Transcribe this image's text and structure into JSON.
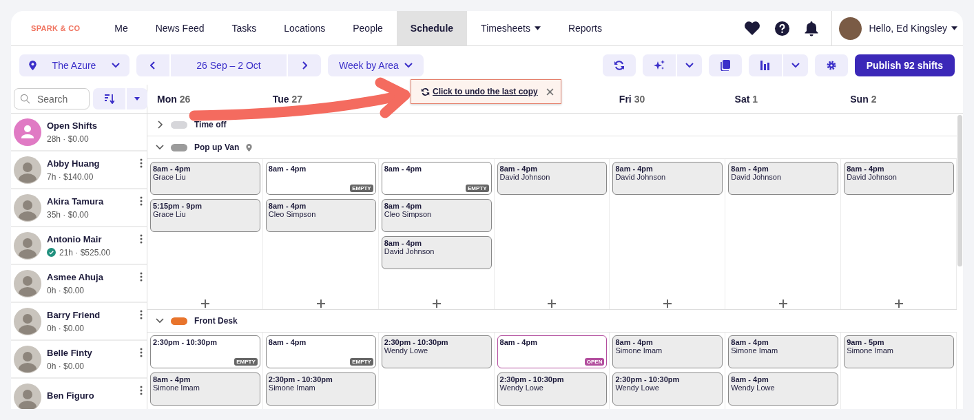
{
  "nav": {
    "logo": "SPARK & CO",
    "tabs": [
      {
        "label": "Me",
        "selected": false,
        "dropdown": false
      },
      {
        "label": "News Feed",
        "selected": false,
        "dropdown": false
      },
      {
        "label": "Tasks",
        "selected": false,
        "dropdown": false
      },
      {
        "label": "Locations",
        "selected": false,
        "dropdown": false
      },
      {
        "label": "People",
        "selected": false,
        "dropdown": false
      },
      {
        "label": "Schedule",
        "selected": true,
        "dropdown": false
      },
      {
        "label": "Timesheets",
        "selected": false,
        "dropdown": true
      },
      {
        "label": "Reports",
        "selected": false,
        "dropdown": false
      }
    ],
    "greeting": "Hello, Ed Kingsley"
  },
  "toolbar": {
    "location": "The Azure",
    "date_range": "26 Sep – 2 Oct",
    "view": "Week by Area",
    "publish": "Publish 92 shifts"
  },
  "toast": {
    "message": "Click to undo the last copy"
  },
  "sidebar": {
    "search": {
      "placeholder": "Search"
    },
    "people": [
      {
        "name": "Open Shifts",
        "summary": "28h · $0.00",
        "kind": "open",
        "verified": false
      },
      {
        "name": "Abby Huang",
        "summary": "7h · $140.00",
        "kind": "person",
        "verified": false
      },
      {
        "name": "Akira Tamura",
        "summary": "35h · $0.00",
        "kind": "person",
        "verified": false
      },
      {
        "name": "Antonio Mair",
        "summary": "21h · $525.00",
        "kind": "person",
        "verified": true
      },
      {
        "name": "Asmee Ahuja",
        "summary": "0h · $0.00",
        "kind": "person",
        "verified": false
      },
      {
        "name": "Barry Friend",
        "summary": "0h · $0.00",
        "kind": "person",
        "verified": false
      },
      {
        "name": "Belle Finty",
        "summary": "0h · $0.00",
        "kind": "person",
        "verified": false
      },
      {
        "name": "Ben Figuro",
        "kind": "person"
      }
    ]
  },
  "days_before_toast": [
    {
      "day": "Mon",
      "date": "26"
    },
    {
      "day": "Tue",
      "date": "27"
    }
  ],
  "days_after_toast": [
    {
      "day": "Fri",
      "date": "30"
    },
    {
      "day": "Sat",
      "date": "1"
    },
    {
      "day": "Sun",
      "date": "2"
    }
  ],
  "areas": [
    {
      "name": "Time off",
      "color": "#d6d6da",
      "expanded": false,
      "has_location": false
    },
    {
      "name": "Pop up Van",
      "color": "#9b9b9b",
      "expanded": true,
      "has_location": true,
      "days": [
        [
          {
            "time": "8am - 4pm",
            "name": "Grace Liu",
            "kind": "assigned"
          },
          {
            "time": "5:15pm - 9pm",
            "name": "Grace Liu",
            "kind": "assigned"
          }
        ],
        [
          {
            "time": "8am - 4pm",
            "kind": "empty",
            "badge": "EMPTY"
          },
          {
            "time": "8am - 4pm",
            "name": "Cleo Simpson",
            "kind": "assigned"
          }
        ],
        [
          {
            "time": "8am - 4pm",
            "kind": "empty",
            "badge": "EMPTY"
          },
          {
            "time": "8am - 4pm",
            "name": "Cleo Simpson",
            "kind": "assigned"
          },
          {
            "time": "8am - 4pm",
            "name": "David Johnson",
            "kind": "assigned"
          }
        ],
        [
          {
            "time": "8am - 4pm",
            "name": "David Johnson",
            "kind": "assigned"
          }
        ],
        [
          {
            "time": "8am - 4pm",
            "name": "David Johnson",
            "kind": "assigned"
          }
        ],
        [
          {
            "time": "8am - 4pm",
            "name": "David Johnson",
            "kind": "assigned"
          }
        ],
        [
          {
            "time": "8am - 4pm",
            "name": "David Johnson",
            "kind": "assigned"
          }
        ]
      ]
    },
    {
      "name": "Front Desk",
      "color": "#e8742c",
      "expanded": true,
      "has_location": false,
      "days": [
        [
          {
            "time": "2:30pm - 10:30pm",
            "kind": "empty",
            "badge": "EMPTY"
          },
          {
            "time": "8am - 4pm",
            "name": "Simone Imam",
            "kind": "assigned"
          }
        ],
        [
          {
            "time": "8am - 4pm",
            "kind": "empty",
            "badge": "EMPTY"
          },
          {
            "time": "2:30pm - 10:30pm",
            "name": "Simone Imam",
            "kind": "assigned"
          }
        ],
        [
          {
            "time": "2:30pm - 10:30pm",
            "name": "Wendy Lowe",
            "kind": "assigned"
          }
        ],
        [
          {
            "time": "8am - 4pm",
            "kind": "open",
            "badge": "OPEN"
          },
          {
            "time": "2:30pm - 10:30pm",
            "name": "Wendy Lowe",
            "kind": "assigned"
          }
        ],
        [
          {
            "time": "8am - 4pm",
            "name": "Simone Imam",
            "kind": "assigned"
          },
          {
            "time": "2:30pm - 10:30pm",
            "name": "Wendy Lowe",
            "kind": "assigned"
          }
        ],
        [
          {
            "time": "8am - 4pm",
            "name": "Simone Imam",
            "kind": "assigned"
          },
          {
            "time": "8am - 4pm",
            "name": "Wendy Lowe",
            "kind": "assigned"
          }
        ],
        [
          {
            "time": "9am - 5pm",
            "name": "Simone Imam",
            "kind": "assigned"
          }
        ]
      ]
    }
  ]
}
